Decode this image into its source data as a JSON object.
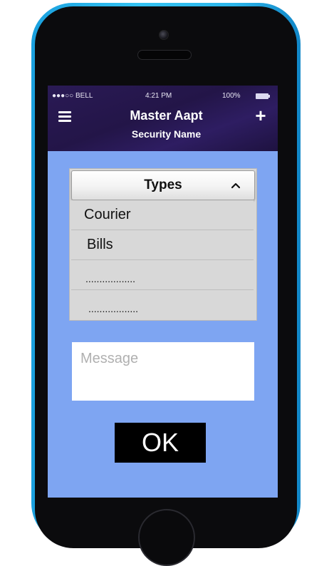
{
  "status_bar": {
    "carrier": "●●●○○ BELL",
    "time": "4:21 PM",
    "battery": "100%"
  },
  "header": {
    "title": "Master Aapt",
    "subtitle": "Security Name",
    "menu_icon": "hamburger-icon",
    "add_icon": "plus-icon"
  },
  "dropdown": {
    "title": "Types",
    "items": [
      "Courier",
      "Bills",
      "..................",
      ".................."
    ]
  },
  "message": {
    "placeholder": "Message",
    "value": ""
  },
  "ok_button": {
    "label": "OK"
  },
  "colors": {
    "phone_frame": "#2db6ea",
    "header_bg": "#241650",
    "screen_bg": "#7ea5f2",
    "button_bg": "#000000"
  }
}
